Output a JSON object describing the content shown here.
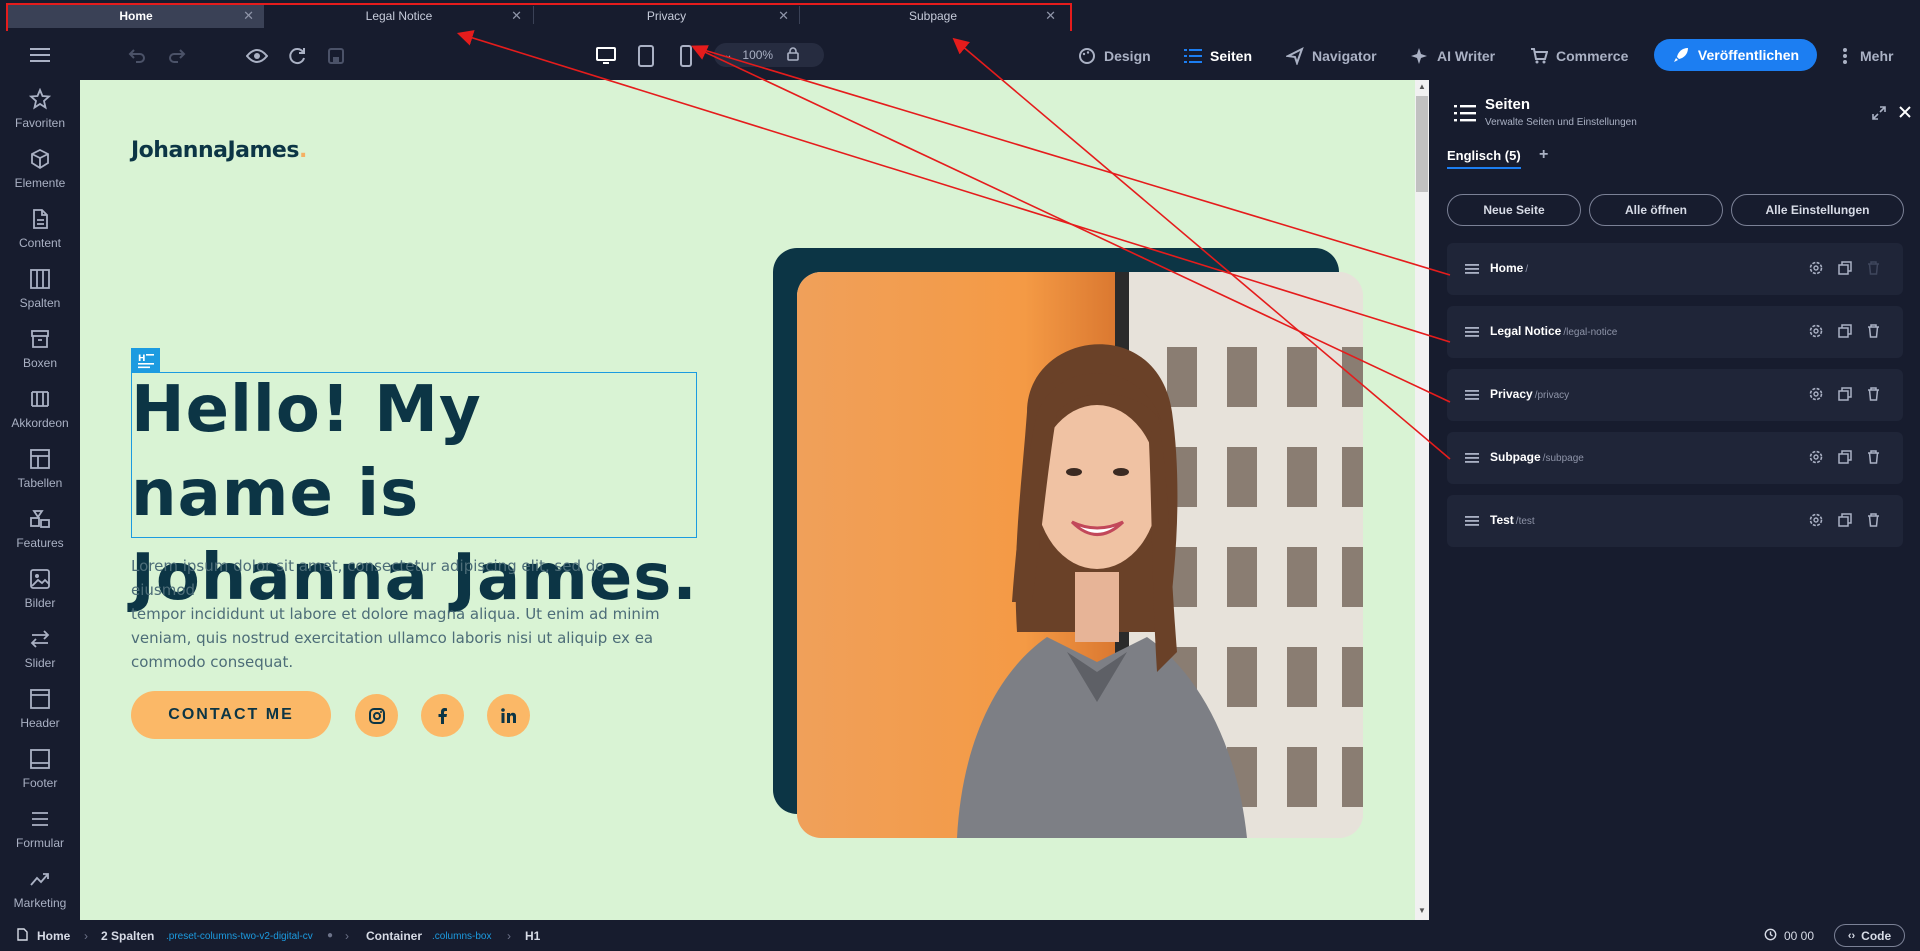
{
  "tabs": [
    {
      "label": "Home",
      "active": true
    },
    {
      "label": "Legal Notice",
      "active": false
    },
    {
      "label": "Privacy",
      "active": false
    },
    {
      "label": "Subpage",
      "active": false
    }
  ],
  "toolbar": {
    "zoom": "100%",
    "nav": {
      "design": "Design",
      "seiten": "Seiten",
      "navigator": "Navigator",
      "ai_writer": "AI Writer",
      "commerce": "Commerce",
      "publish": "Veröffentlichen",
      "mehr": "Mehr"
    }
  },
  "sidebar": {
    "items": [
      {
        "label": "Favoriten",
        "icon": "star-icon"
      },
      {
        "label": "Elemente",
        "icon": "cube-icon"
      },
      {
        "label": "Content",
        "icon": "document-icon"
      },
      {
        "label": "Spalten",
        "icon": "columns-icon"
      },
      {
        "label": "Boxen",
        "icon": "box-icon"
      },
      {
        "label": "Akkordeon",
        "icon": "accordion-icon"
      },
      {
        "label": "Tabellen",
        "icon": "table-icon"
      },
      {
        "label": "Features",
        "icon": "features-icon"
      },
      {
        "label": "Bilder",
        "icon": "image-icon"
      },
      {
        "label": "Slider",
        "icon": "slider-icon"
      },
      {
        "label": "Header",
        "icon": "header-icon"
      },
      {
        "label": "Footer",
        "icon": "footer-icon"
      },
      {
        "label": "Formular",
        "icon": "form-icon"
      },
      {
        "label": "Marketing",
        "icon": "marketing-icon"
      }
    ]
  },
  "site": {
    "logo": "JohannaJames",
    "logo_dot": ".",
    "h1_line1": "Hello! My name is",
    "h1_line2": "Johanna James.",
    "lorem_1": "Lorem ipsum dolor sit amet, consectetur adipiscing elit, sed do eiusmod",
    "lorem_2": "tempor incididunt ut labore et dolore magna aliqua. Ut enim ad minim",
    "lorem_3": "veniam, quis nostrud exercitation ullamco laboris nisi ut aliquip ex ea",
    "lorem_4": "commodo consequat.",
    "contact": "CONTACT ME"
  },
  "panel": {
    "title": "Seiten",
    "subtitle": "Verwalte Seiten und Einstellungen",
    "language_tab": "Englisch (5)",
    "buttons": {
      "new_page": "Neue Seite",
      "open_all": "Alle öffnen",
      "all_settings": "Alle Einstellungen"
    },
    "pages": [
      {
        "name": "Home",
        "slug": "/"
      },
      {
        "name": "Legal Notice",
        "slug": "/legal-notice"
      },
      {
        "name": "Privacy",
        "slug": "/privacy"
      },
      {
        "name": "Subpage",
        "slug": "/subpage"
      },
      {
        "name": "Test",
        "slug": "/test"
      }
    ]
  },
  "statusbar": {
    "crumb1": "Home",
    "crumb2": "2 Spalten",
    "crumb2_class": ".preset-columns-two-v2-digital-cv",
    "crumb3": "Container",
    "crumb3_class": ".columns-box",
    "crumb4": "H1",
    "timer": "00 00",
    "code": "Code"
  },
  "colors": {
    "accent": "#1c7ef2",
    "canvas_bg": "#d9f3d4",
    "brand_dark": "#0c3545",
    "brand_orange": "#fbb867",
    "annotation_red": "#e51c1c"
  }
}
